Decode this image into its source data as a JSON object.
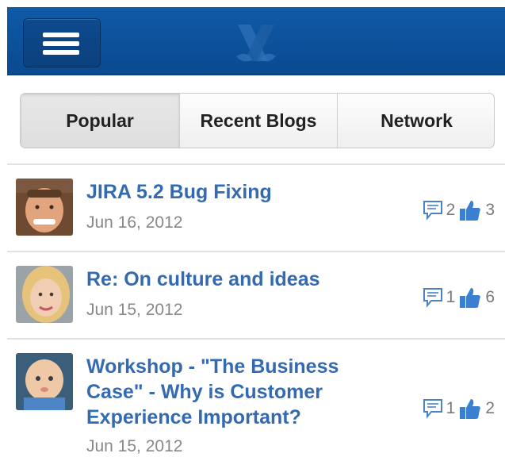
{
  "header": {
    "menu_icon": "hamburger-menu-icon",
    "logo_icon": "crossed-logo-icon",
    "colors": {
      "bar": "#0f5aa7",
      "accent_text": "#336ab0"
    }
  },
  "tabs": [
    {
      "label": "Popular",
      "active": true
    },
    {
      "label": "Recent Blogs",
      "active": false
    },
    {
      "label": "Network",
      "active": false
    }
  ],
  "posts": [
    {
      "title": "JIRA 5.2 Bug Fixing",
      "date": "Jun 16, 2012",
      "comments": "2",
      "likes": "3",
      "avatar": "man-smiling-avatar"
    },
    {
      "title": "Re: On culture and ideas",
      "date": "Jun 15, 2012",
      "comments": "1",
      "likes": "6",
      "avatar": "blonde-woman-avatar"
    },
    {
      "title": "Workshop - \"The Business Case\" - Why is Customer Experience Important?",
      "date": "Jun 15, 2012",
      "comments": "1",
      "likes": "2",
      "avatar": "baby-avatar"
    }
  ]
}
